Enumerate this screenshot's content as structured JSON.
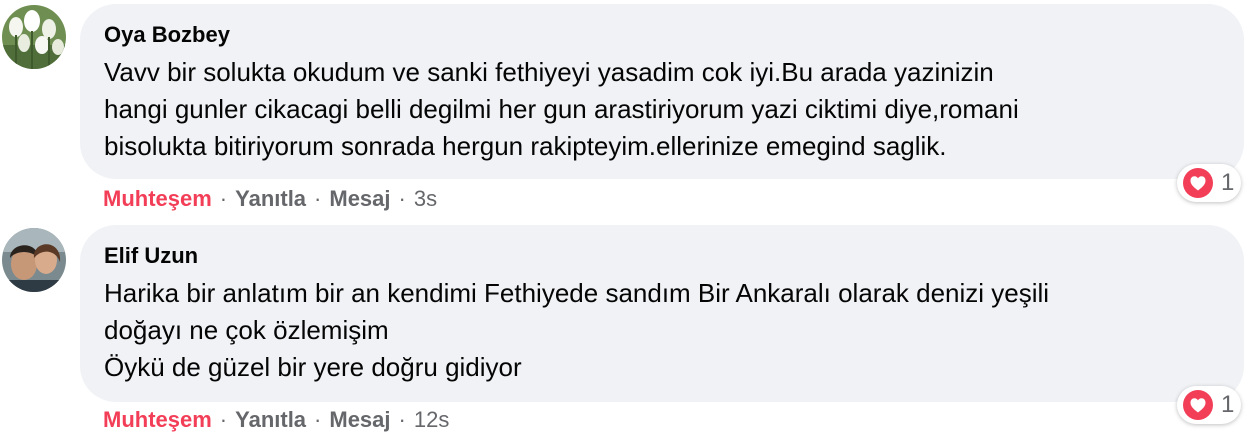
{
  "comments": [
    {
      "author": "Oya Bozbey",
      "body": "Vavv bir solukta okudum ve sanki fethiyeyi yasadim cok iyi.Bu arada yazinizin\nhangi gunler cikacagi belli degilmi her gun arastiriyorum yazi ciktimi diye,romani\nbisolukta bitiriyorum sonrada hergun rakipteyim.ellerinize emegind saglik.",
      "reaction_label": "Muhteşem",
      "reply_label": "Yanıtla",
      "message_label": "Mesaj",
      "separator": "·",
      "timestamp": "3s",
      "reaction_count": "1",
      "reaction_icon": "heart-icon",
      "avatar_icon": "tulips-avatar"
    },
    {
      "author": "Elif Uzun",
      "body": "Harika bir anlatım bir an kendimi Fethiyede sandım Bir Ankaralı olarak denizi yeşili\ndoğayı ne çok özlemişim\nÖykü de güzel bir yere doğru gidiyor",
      "reaction_label": "Muhteşem",
      "reply_label": "Yanıtla",
      "message_label": "Mesaj",
      "separator": "·",
      "timestamp": "12s",
      "reaction_count": "1",
      "reaction_icon": "heart-icon",
      "avatar_icon": "people-photo-avatar"
    }
  ],
  "colors": {
    "bubble_background": "#f0f2f5",
    "reaction_label": "#f33e58",
    "secondary_text": "#65676b",
    "heart": "#f33e58"
  }
}
